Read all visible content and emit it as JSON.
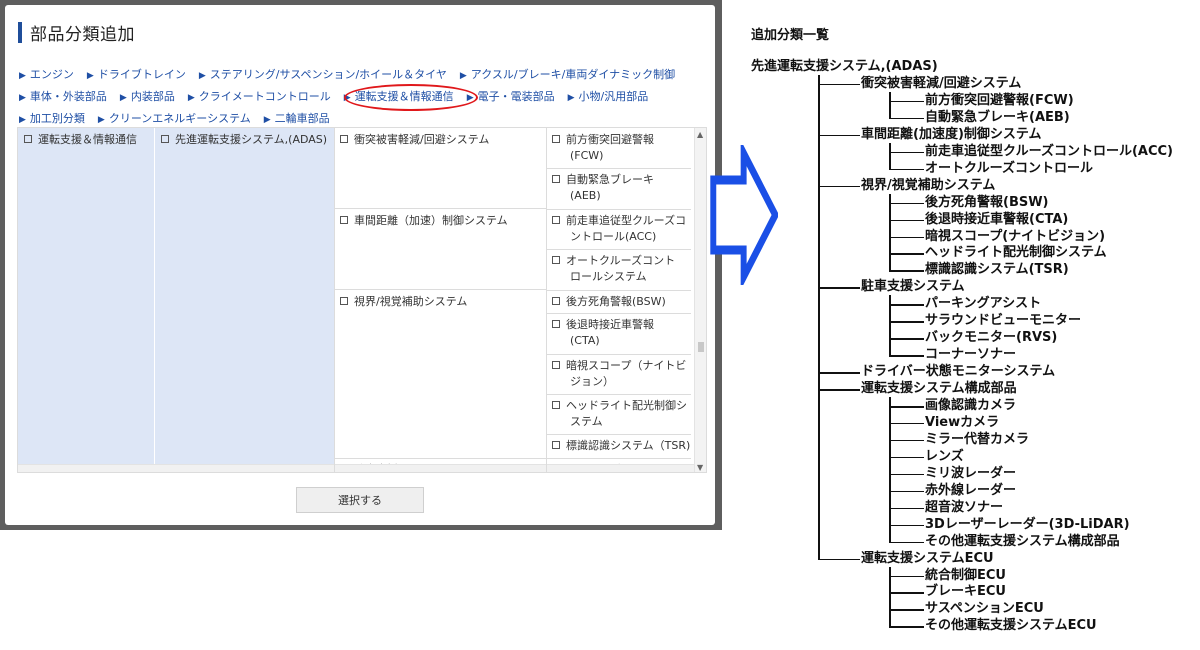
{
  "modal": {
    "title": "部品分類追加",
    "nav_rows": [
      [
        "エンジン",
        "ドライブトレイン",
        "ステアリング/サスペンション/ホイール＆タイヤ",
        "アクスル/ブレーキ/車両ダイナミック制御"
      ],
      [
        "車体・外装部品",
        "内装部品",
        "クライメートコントロール",
        "運転支援＆情報通信",
        "電子・電装部品",
        "小物/汎用部品"
      ],
      [
        "加工別分類",
        "クリーンエネルギーシステム",
        "二輪車部品"
      ]
    ],
    "table": {
      "col1": "運転支援＆情報通信",
      "col2": "先進運転支援システム,(ADAS)",
      "col3": [
        "衝突被害軽減/回避システム",
        "車間距離（加速）制御システム",
        "視界/視覚補助システム",
        "駐車支援システム"
      ],
      "col4": [
        [
          "前方衝突回避警報",
          "(FCW)"
        ],
        [
          "自動緊急ブレーキ",
          "(AEB)"
        ],
        [
          "前走車追従型クルーズコ",
          "ントロール(ACC)"
        ],
        [
          "オートクルーズコント",
          "ロールシステム"
        ],
        [
          "後方死角警報(BSW)"
        ],
        [
          "後退時接近車警報",
          "(CTA)"
        ],
        [
          "暗視スコープ（ナイトビ",
          "ジョン）"
        ],
        [
          "ヘッドライト配光制御シ",
          "ステム"
        ],
        [
          "標識認識システム（TSR)"
        ],
        [
          "パーキングアシスト"
        ]
      ]
    },
    "select_button": "選択する"
  },
  "tree": {
    "heading": "追加分類一覧",
    "root": "先進運転支援システム,(ADAS)",
    "items": [
      {
        "label": "衝突被害軽減/回避システム",
        "children": [
          "前方衝突回避警報(FCW)",
          "自動緊急ブレーキ(AEB)"
        ]
      },
      {
        "label": "車間距離(加速度)制御システム",
        "children": [
          "前走車追従型クルーズコントロール(ACC)",
          "オートクルーズコントロール"
        ]
      },
      {
        "label": "視界/視覚補助システム",
        "children": [
          "後方死角警報(BSW)",
          "後退時接近車警報(CTA)",
          "暗視スコープ(ナイトビジョン)",
          "ヘッドライト配光制御システム",
          "標識認識システム(TSR)"
        ]
      },
      {
        "label": "駐車支援システム",
        "children": [
          "パーキングアシスト",
          "サラウンドビューモニター",
          "バックモニター(RVS)",
          "コーナーソナー"
        ]
      },
      {
        "label": "ドライバー状態モニターシステム",
        "children": []
      },
      {
        "label": "運転支援システム構成部品",
        "children": [
          "画像認識カメラ",
          "Viewカメラ",
          "ミラー代替カメラ",
          "レンズ",
          "ミリ波レーダー",
          "赤外線レーダー",
          "超音波ソナー",
          "3Dレーザーレーダー(3D-LiDAR)",
          "その他運転支援システム構成部品"
        ]
      },
      {
        "label": "運転支援システムECU",
        "children": [
          "統合制御ECU",
          "ブレーキECU",
          "サスペンションECU",
          "その他運転支援システムECU"
        ]
      }
    ]
  },
  "colors": {
    "accent_blue": "#1f4fa5",
    "arrow_blue": "#1a4fe6",
    "highlight_red": "#e0181b",
    "column_fill": "#dde6f6",
    "overlay_gray": "#5e5e5e"
  },
  "icons": {
    "nav_bullet": "triangle-right-icon",
    "checkbox": "checkbox-icon",
    "big_arrow": "arrow-right-icon"
  }
}
